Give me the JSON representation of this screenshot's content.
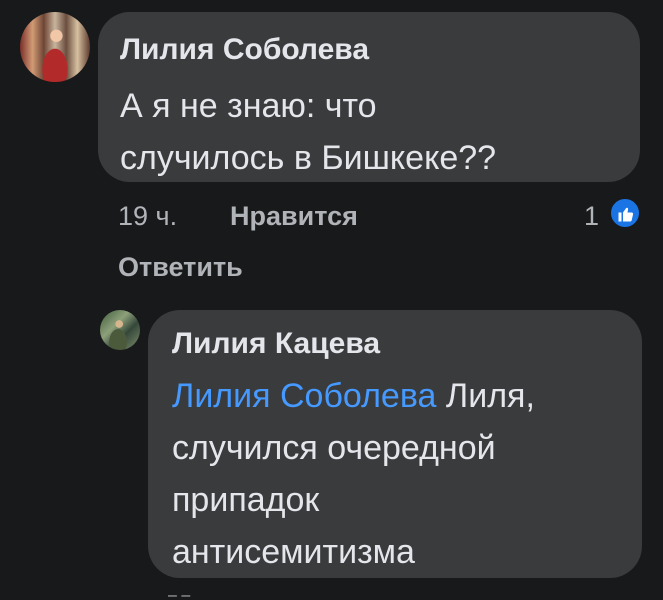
{
  "comment1": {
    "author": "Лилия Соболева",
    "text_line1": "А я не знаю: что",
    "text_line2": "случилось  в Бишкеке??",
    "time": "19 ч.",
    "like_label": "Нравится",
    "reply_label": "Ответить",
    "reaction_count": "1",
    "reaction_icon": "like-icon",
    "avatar_icon": "user-avatar"
  },
  "comment2": {
    "author": "Лилия Кацева",
    "mention": "Лилия Соболева",
    "text_line1_rest": " Лиля,",
    "text_line2": "случился очередной",
    "text_line3": "припадок",
    "text_line4": "антисемитизма",
    "avatar_icon": "user-avatar"
  },
  "colors": {
    "background": "#18191a",
    "bubble": "#3a3b3c",
    "primary_text": "#e4e6eb",
    "secondary_text": "#b0b3b8",
    "mention": "#4599ff",
    "like_blue": "#1b74e4"
  }
}
